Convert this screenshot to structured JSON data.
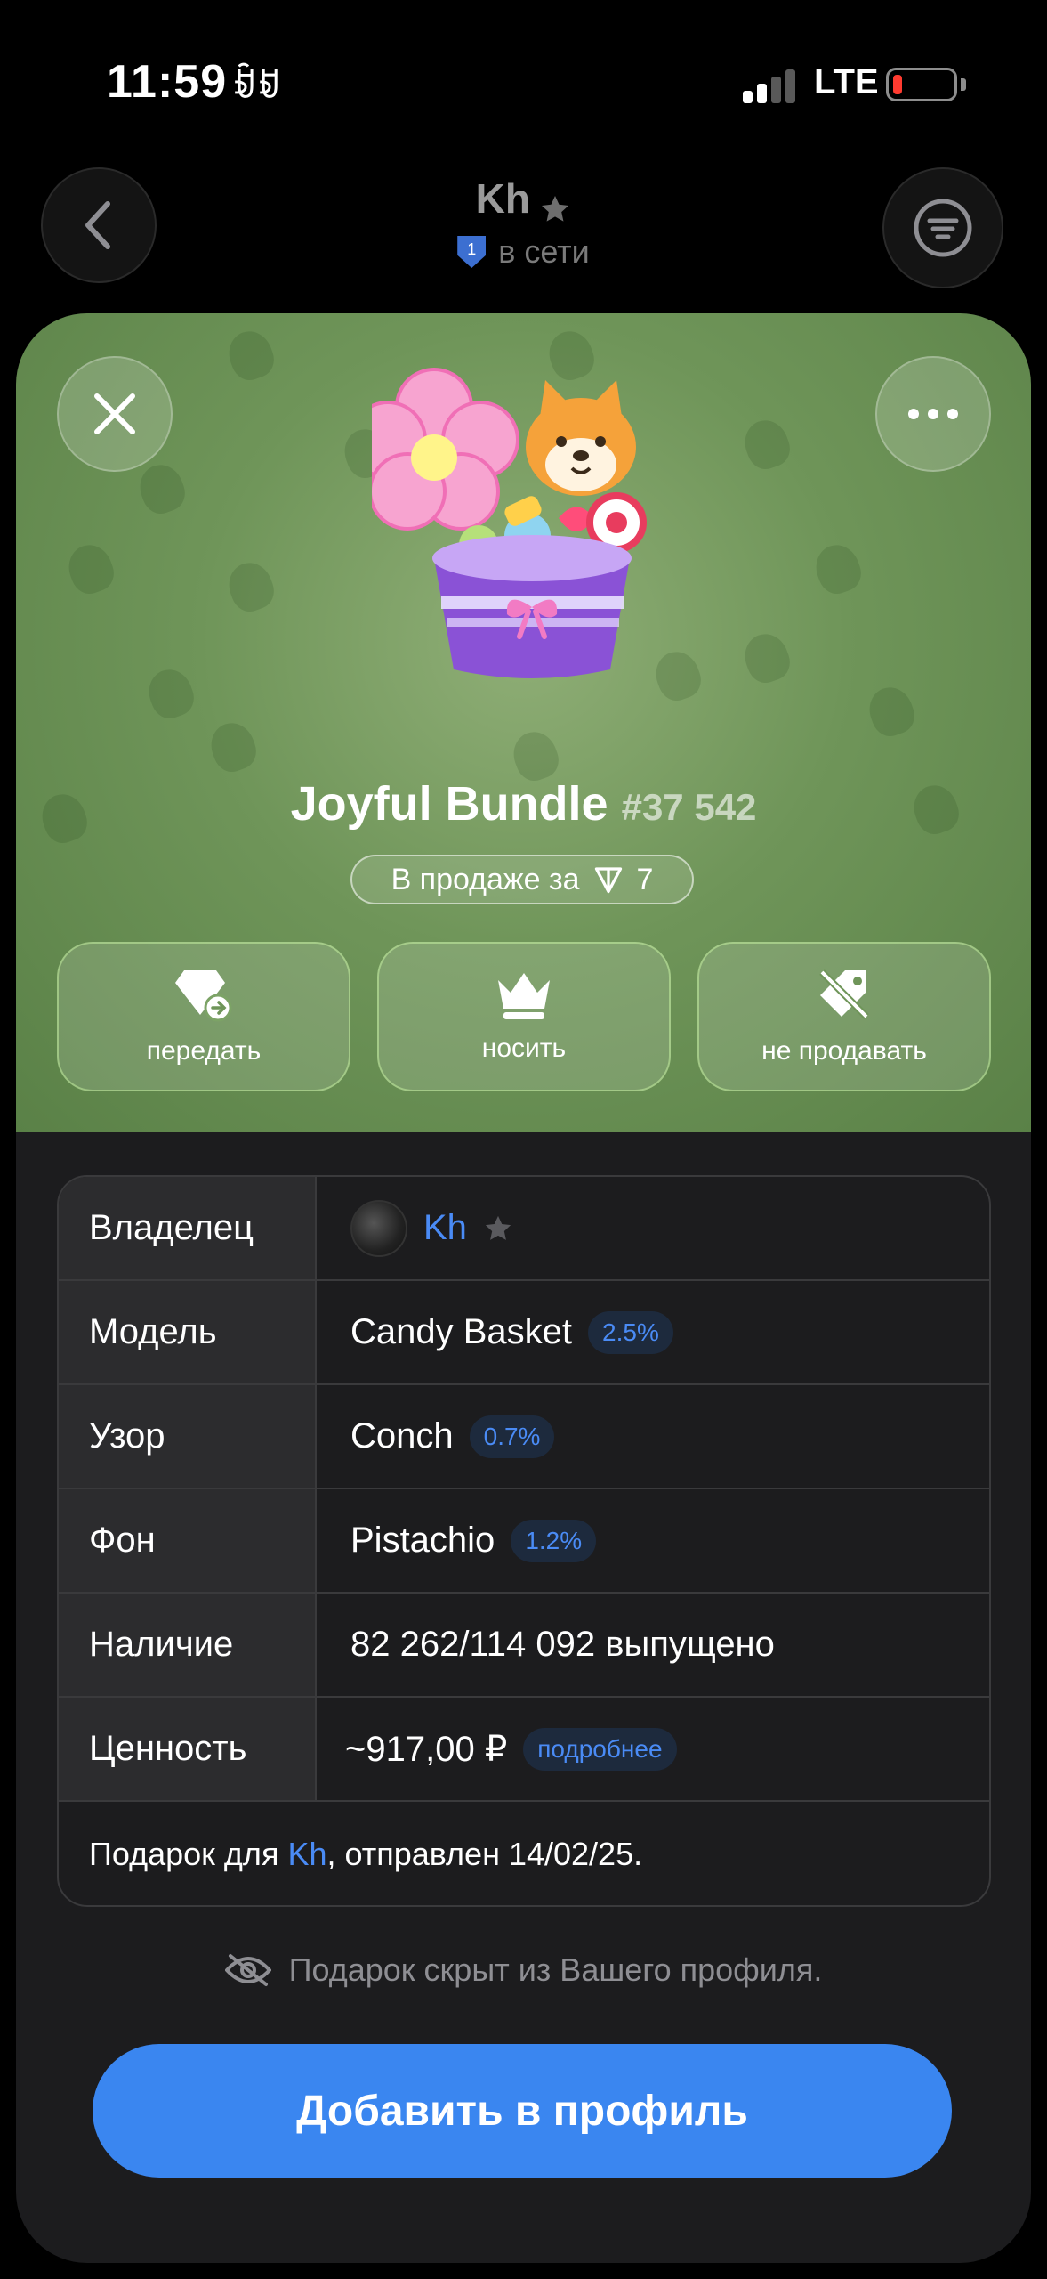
{
  "status_bar": {
    "time": "11:59",
    "time_glyph": "ꀁꀂ",
    "network": "LTE",
    "battery_level": 0.1,
    "signal_bars": 2
  },
  "chat_header": {
    "name": "Kh",
    "status": "в сети",
    "badge_number": "1",
    "icons": [
      "back-chevron-icon",
      "filter-icon",
      "star-icon",
      "shield-icon"
    ]
  },
  "gift": {
    "title": "Joyful Bundle",
    "number": "#37 542",
    "sale_prefix": "В продаже за",
    "sale_price": "7",
    "sale_currency_icon": "ton-diamond-icon",
    "hero_color": "#6f9559",
    "actions": [
      {
        "label": "передать",
        "icon": "gem-transfer-icon"
      },
      {
        "label": "носить",
        "icon": "crown-icon"
      },
      {
        "label": "не продавать",
        "icon": "tag-off-icon"
      }
    ]
  },
  "info": {
    "rows": [
      {
        "key": "Владелец",
        "value": "Kh"
      },
      {
        "key": "Модель",
        "value": "Candy Basket",
        "badge": "2.5%"
      },
      {
        "key": "Узор",
        "value": "Conch",
        "badge": "0.7%"
      },
      {
        "key": "Фон",
        "value": "Pistachio",
        "badge": "1.2%"
      },
      {
        "key": "Наличие",
        "value": "82 262/114 092 выпущено"
      },
      {
        "key": "Ценность",
        "value": "~917,00 ₽",
        "link": "подробнее"
      }
    ],
    "note_prefix": "Подарок для ",
    "note_name": "Kh",
    "note_suffix": ", отправлен 14/02/25.",
    "accent_color": "#4a8bf5"
  },
  "hidden_note": "Подарок скрыт из Вашего профиля.",
  "primary_button": "Добавить в профиль",
  "primary_color": "#3a86f0"
}
